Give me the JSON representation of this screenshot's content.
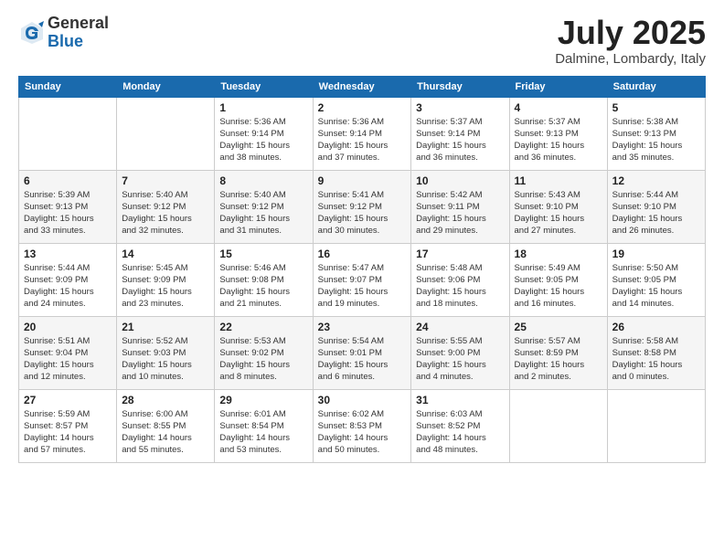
{
  "header": {
    "logo_general": "General",
    "logo_blue": "Blue",
    "month_title": "July 2025",
    "location": "Dalmine, Lombardy, Italy"
  },
  "days_of_week": [
    "Sunday",
    "Monday",
    "Tuesday",
    "Wednesday",
    "Thursday",
    "Friday",
    "Saturday"
  ],
  "weeks": [
    [
      {
        "day": "",
        "info": ""
      },
      {
        "day": "",
        "info": ""
      },
      {
        "day": "1",
        "info": "Sunrise: 5:36 AM\nSunset: 9:14 PM\nDaylight: 15 hours\nand 38 minutes."
      },
      {
        "day": "2",
        "info": "Sunrise: 5:36 AM\nSunset: 9:14 PM\nDaylight: 15 hours\nand 37 minutes."
      },
      {
        "day": "3",
        "info": "Sunrise: 5:37 AM\nSunset: 9:14 PM\nDaylight: 15 hours\nand 36 minutes."
      },
      {
        "day": "4",
        "info": "Sunrise: 5:37 AM\nSunset: 9:13 PM\nDaylight: 15 hours\nand 36 minutes."
      },
      {
        "day": "5",
        "info": "Sunrise: 5:38 AM\nSunset: 9:13 PM\nDaylight: 15 hours\nand 35 minutes."
      }
    ],
    [
      {
        "day": "6",
        "info": "Sunrise: 5:39 AM\nSunset: 9:13 PM\nDaylight: 15 hours\nand 33 minutes."
      },
      {
        "day": "7",
        "info": "Sunrise: 5:40 AM\nSunset: 9:12 PM\nDaylight: 15 hours\nand 32 minutes."
      },
      {
        "day": "8",
        "info": "Sunrise: 5:40 AM\nSunset: 9:12 PM\nDaylight: 15 hours\nand 31 minutes."
      },
      {
        "day": "9",
        "info": "Sunrise: 5:41 AM\nSunset: 9:12 PM\nDaylight: 15 hours\nand 30 minutes."
      },
      {
        "day": "10",
        "info": "Sunrise: 5:42 AM\nSunset: 9:11 PM\nDaylight: 15 hours\nand 29 minutes."
      },
      {
        "day": "11",
        "info": "Sunrise: 5:43 AM\nSunset: 9:10 PM\nDaylight: 15 hours\nand 27 minutes."
      },
      {
        "day": "12",
        "info": "Sunrise: 5:44 AM\nSunset: 9:10 PM\nDaylight: 15 hours\nand 26 minutes."
      }
    ],
    [
      {
        "day": "13",
        "info": "Sunrise: 5:44 AM\nSunset: 9:09 PM\nDaylight: 15 hours\nand 24 minutes."
      },
      {
        "day": "14",
        "info": "Sunrise: 5:45 AM\nSunset: 9:09 PM\nDaylight: 15 hours\nand 23 minutes."
      },
      {
        "day": "15",
        "info": "Sunrise: 5:46 AM\nSunset: 9:08 PM\nDaylight: 15 hours\nand 21 minutes."
      },
      {
        "day": "16",
        "info": "Sunrise: 5:47 AM\nSunset: 9:07 PM\nDaylight: 15 hours\nand 19 minutes."
      },
      {
        "day": "17",
        "info": "Sunrise: 5:48 AM\nSunset: 9:06 PM\nDaylight: 15 hours\nand 18 minutes."
      },
      {
        "day": "18",
        "info": "Sunrise: 5:49 AM\nSunset: 9:05 PM\nDaylight: 15 hours\nand 16 minutes."
      },
      {
        "day": "19",
        "info": "Sunrise: 5:50 AM\nSunset: 9:05 PM\nDaylight: 15 hours\nand 14 minutes."
      }
    ],
    [
      {
        "day": "20",
        "info": "Sunrise: 5:51 AM\nSunset: 9:04 PM\nDaylight: 15 hours\nand 12 minutes."
      },
      {
        "day": "21",
        "info": "Sunrise: 5:52 AM\nSunset: 9:03 PM\nDaylight: 15 hours\nand 10 minutes."
      },
      {
        "day": "22",
        "info": "Sunrise: 5:53 AM\nSunset: 9:02 PM\nDaylight: 15 hours\nand 8 minutes."
      },
      {
        "day": "23",
        "info": "Sunrise: 5:54 AM\nSunset: 9:01 PM\nDaylight: 15 hours\nand 6 minutes."
      },
      {
        "day": "24",
        "info": "Sunrise: 5:55 AM\nSunset: 9:00 PM\nDaylight: 15 hours\nand 4 minutes."
      },
      {
        "day": "25",
        "info": "Sunrise: 5:57 AM\nSunset: 8:59 PM\nDaylight: 15 hours\nand 2 minutes."
      },
      {
        "day": "26",
        "info": "Sunrise: 5:58 AM\nSunset: 8:58 PM\nDaylight: 15 hours\nand 0 minutes."
      }
    ],
    [
      {
        "day": "27",
        "info": "Sunrise: 5:59 AM\nSunset: 8:57 PM\nDaylight: 14 hours\nand 57 minutes."
      },
      {
        "day": "28",
        "info": "Sunrise: 6:00 AM\nSunset: 8:55 PM\nDaylight: 14 hours\nand 55 minutes."
      },
      {
        "day": "29",
        "info": "Sunrise: 6:01 AM\nSunset: 8:54 PM\nDaylight: 14 hours\nand 53 minutes."
      },
      {
        "day": "30",
        "info": "Sunrise: 6:02 AM\nSunset: 8:53 PM\nDaylight: 14 hours\nand 50 minutes."
      },
      {
        "day": "31",
        "info": "Sunrise: 6:03 AM\nSunset: 8:52 PM\nDaylight: 14 hours\nand 48 minutes."
      },
      {
        "day": "",
        "info": ""
      },
      {
        "day": "",
        "info": ""
      }
    ]
  ]
}
